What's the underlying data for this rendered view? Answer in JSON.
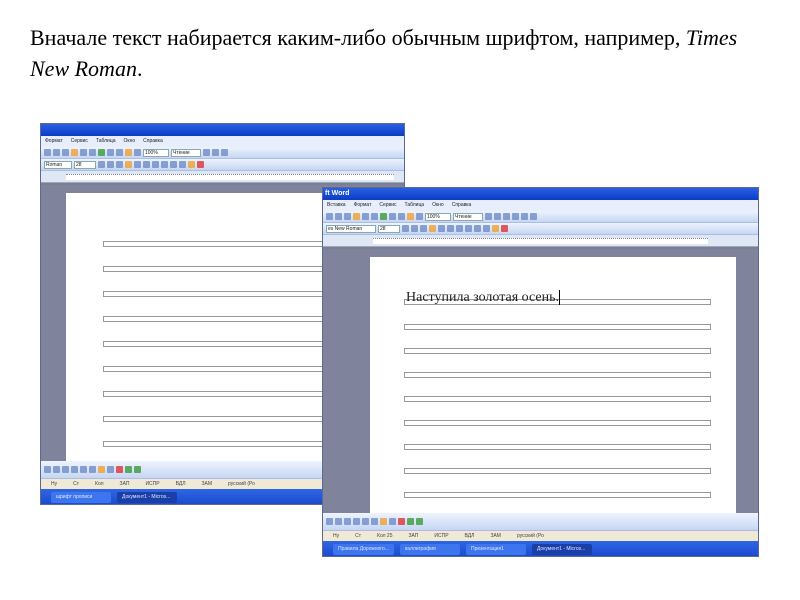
{
  "slide": {
    "heading_part1": "Вначале текст набирается каким-либо обычным шрифтом, например, ",
    "heading_font": "Times New Roman",
    "heading_end": "."
  },
  "left_window": {
    "menu": [
      "Формат",
      "Сервис",
      "Таблица",
      "Окно",
      "Справка"
    ],
    "font_name": "Roman",
    "font_size": "28",
    "zoom": "100%",
    "read_label": "Чтение",
    "status": [
      "Ну",
      "Ст",
      "Кол",
      "ЗАП",
      "ИСПР",
      "ВДЛ",
      "ЗАМ",
      "русский (Ро"
    ],
    "taskbar": [
      "шрифт прописи",
      "Документ1 - Micros..."
    ]
  },
  "right_window": {
    "title": "ft Word",
    "menu": [
      "Вставка",
      "Формат",
      "Сервис",
      "Таблица",
      "Окно",
      "Справка"
    ],
    "font_name": "es New Roman",
    "font_size": "28",
    "zoom": "100%",
    "read_label": "Чтение",
    "document_text": "Наступила золотая осень.",
    "status": [
      "Ну",
      "Ст",
      "Кол 25",
      "ЗАП",
      "ИСПР",
      "ВДЛ",
      "ЗАМ",
      "русский (Ро"
    ],
    "taskbar": [
      "Правила Дорожного...",
      "каллиграфия",
      "Презентация1",
      "Документ1 - Micros..."
    ]
  },
  "colors": {
    "titlebar": "#0a3cc8",
    "taskbar": "#1948c9",
    "workspace": "#80839c"
  }
}
